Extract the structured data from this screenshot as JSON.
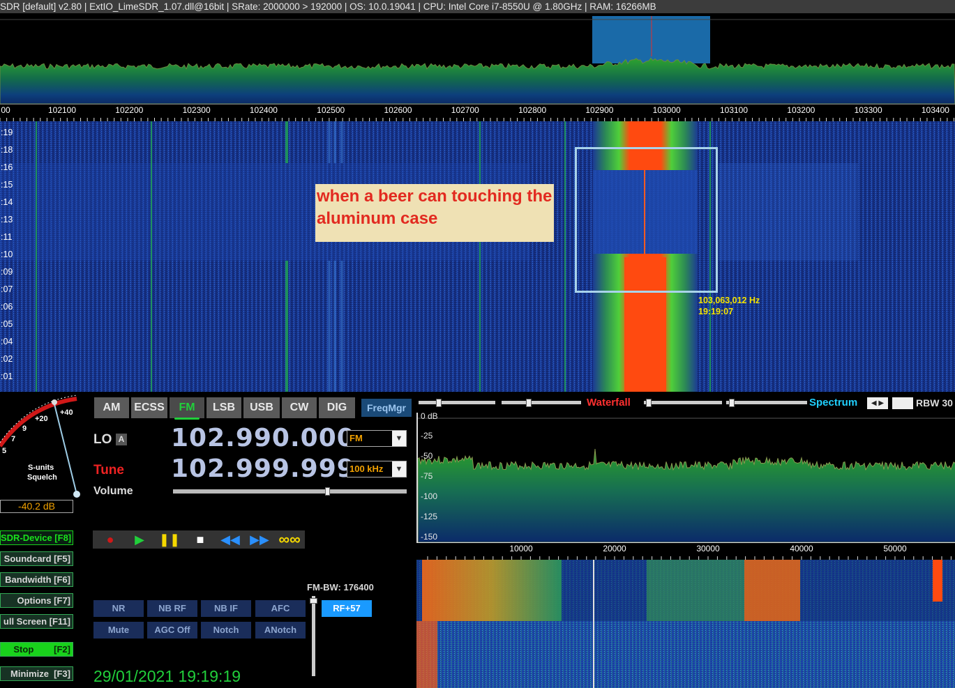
{
  "titlebar": "SDR  [default]  v2.80   |  ExtIO_LimeSDR_1.07.dll@16bit  |  SRate: 2000000 > 192000  |  OS: 10.0.19041  |  CPU: Intel Core i7-8550U @ 1.80GHz  |  RAM: 16266MB",
  "top_scale": {
    "ticks": [
      "00",
      "102100",
      "102200",
      "102300",
      "102400",
      "102500",
      "102600",
      "102700",
      "102800",
      "102900",
      "103000",
      "103100",
      "103200",
      "103300",
      "103400"
    ]
  },
  "waterfall": {
    "time_labels": [
      ":19",
      ":18",
      ":16",
      ":15",
      ":14",
      ":13",
      ":11",
      ":10",
      ":09",
      ":07",
      ":06",
      ":05",
      ":04",
      ":02",
      ":01"
    ],
    "annotation": "when a beer can touching the aluminum case",
    "cursor_freq": "103,063,012 Hz",
    "cursor_time": "19:19:07"
  },
  "smeter": {
    "scale_labels": [
      "+20",
      "+40",
      "9",
      "7",
      "5"
    ],
    "caption1": "S-units",
    "caption2": "Squelch",
    "level": "-40.2 dB"
  },
  "left_buttons": [
    {
      "label": "SDR-Device [F8]"
    },
    {
      "label": "Soundcard [F5]"
    },
    {
      "label": "Bandwidth [F6]"
    },
    {
      "label": "Options [F7]"
    },
    {
      "label": "ull Screen [F11]"
    },
    {
      "label": "Stop        [F2]"
    },
    {
      "label": "Minimize  [F3]"
    }
  ],
  "datetime": "29/01/2021 19:19:19",
  "modes": [
    "AM",
    "ECSS",
    "FM",
    "LSB",
    "USB",
    "CW",
    "DIG"
  ],
  "active_mode": "FM",
  "freqmgr": "FreqMgr",
  "lo": {
    "label": "LO",
    "badge": "A",
    "freq": "102.990.000",
    "mode": "FM"
  },
  "tune": {
    "label": "Tune",
    "freq": "102.999.999",
    "step": "100 kHz"
  },
  "volume_label": "Volume",
  "volume_level": 0.66,
  "transport_icons": [
    "record-icon",
    "play-icon",
    "pause-icon",
    "stop-icon",
    "rewind-icon",
    "forward-icon",
    "loop-icon"
  ],
  "dsp_buttons": {
    "row1": [
      "NR",
      "NB RF",
      "NB IF",
      "AFC"
    ],
    "row2": [
      "Mute",
      "AGC Off",
      "Notch",
      "ANotch"
    ]
  },
  "fmbw": "FM-BW: 176400",
  "rf_button": "RF+57",
  "right": {
    "waterfall_label": "Waterfall",
    "spectrum_label": "Spectrum",
    "rbw_label": "RBW 30",
    "db_labels": [
      "0 dB",
      "-25",
      "-50",
      "-75",
      "-100",
      "-125",
      "-150"
    ],
    "scale_ticks": [
      "10000",
      "20000",
      "30000",
      "40000",
      "50000"
    ]
  },
  "colors": {
    "accent_red": "#e22a20",
    "mode_active_green": "#21cf3b",
    "spectrum_label": "#20d0ff",
    "waterfall_label": "#ff3030"
  }
}
